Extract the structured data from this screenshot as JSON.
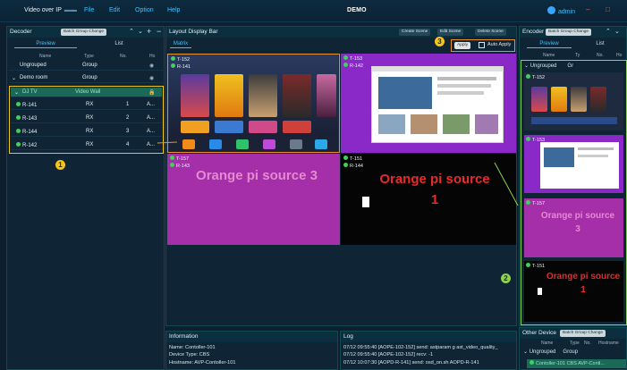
{
  "app": {
    "name": "Video over IP",
    "title": "DEMO",
    "user": "admin"
  },
  "menu": [
    "File",
    "Edit",
    "Option",
    "Help"
  ],
  "decoder": {
    "title": "Decoder",
    "batch_label": "Batch Group Change",
    "tabs": [
      "Preview",
      "List"
    ],
    "columns": [
      "Name",
      "Type",
      "No.",
      "Ho"
    ],
    "groups": [
      {
        "name": "Ungrouped",
        "type": "Group"
      },
      {
        "name": "Demo room",
        "type": "Group"
      }
    ],
    "video_wall": {
      "name": "DJ TV",
      "type": "Video Wall"
    },
    "rows": [
      {
        "name": "R-141",
        "type": "RX",
        "no": "1",
        "ho": "A..."
      },
      {
        "name": "R-143",
        "type": "RX",
        "no": "2",
        "ho": "A..."
      },
      {
        "name": "R-144",
        "type": "RX",
        "no": "3",
        "ho": "A..."
      },
      {
        "name": "R-142",
        "type": "RX",
        "no": "4",
        "ho": "A..."
      }
    ]
  },
  "layout": {
    "title": "Layout Display Bar",
    "tab": "Matrix",
    "buttons": {
      "create": "Create Scene",
      "edit": "Edit Scene",
      "delete": "Delete Scene",
      "apply": "Apply",
      "auto_apply": "Auto Apply"
    },
    "cells": [
      {
        "tx": "T-152",
        "rx": "R-141"
      },
      {
        "tx": "T-153",
        "rx": "R-142"
      },
      {
        "tx": "T-157",
        "rx": "R-143",
        "text": "Orange pi source 3"
      },
      {
        "tx": "T-151",
        "rx": "R-144",
        "text": "Orange pi source 1"
      }
    ]
  },
  "encoder": {
    "title": "Encoder",
    "batch_label": "Batch Group Change",
    "tabs": [
      "Preview",
      "List"
    ],
    "columns": [
      "Name",
      "Ty",
      "No.",
      "Ho"
    ],
    "group": {
      "name": "Ungrouped",
      "type": "Gr"
    },
    "thumbs": [
      {
        "tx": "T-152"
      },
      {
        "tx": "T-153"
      },
      {
        "tx": "T-157",
        "text": "Orange pi source 3"
      },
      {
        "tx": "T-151",
        "text": "Orange pi source 1"
      }
    ]
  },
  "information": {
    "title": "Information",
    "lines": [
      "Name: Contoller-101",
      "Device Type: CBS",
      "Hostname: AVP-Contoller-101"
    ]
  },
  "log": {
    "title": "Log",
    "lines": [
      "07/12 09:55:40 [AOPE-102-152] send: astparam g ast_video_quality_",
      "07/12 09:55:40 [AOPE-102-152] recv: -1",
      "07/12 10:07:30 [AOPD-R-141] send: osd_on.sh AOPD-R-141"
    ]
  },
  "other_device": {
    "title": "Other Device",
    "batch_label": "Batch Group Change",
    "columns": [
      "Name",
      "Type",
      "No.",
      "Hostname"
    ],
    "group": {
      "name": "Ungrouped",
      "type": "Group"
    },
    "row": {
      "name": "Contoller-101",
      "type": "CBS",
      "host": "AVP-Contl..."
    }
  },
  "badges": [
    "1",
    "2",
    "3"
  ],
  "colors": {
    "accent": "#3ec1ff",
    "purple": "#a52fa8",
    "online": "#3fd15a",
    "highlight_orange": "#e8922b",
    "highlight_green": "#8cd24c",
    "highlight_yellow": "#f0c21e",
    "text_red": "#e82a2a"
  }
}
